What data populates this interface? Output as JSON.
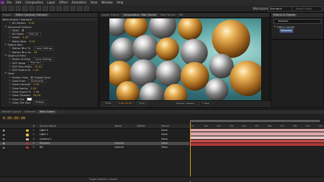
{
  "menu": {
    "items": [
      "File",
      "Edit",
      "Composition",
      "Layer",
      "Effect",
      "Animation",
      "View",
      "Window",
      "Help"
    ]
  },
  "toolbar": {
    "workspace_label": "Workspace:",
    "workspace_value": "Standard",
    "search_placeholder": "Search Help"
  },
  "effect_controls": {
    "tabs": [
      "Project",
      "Effect Controls: Element"
    ],
    "header": "Main Scene • Element",
    "rows": [
      {
        "label": "AO Darken",
        "value": "0.00",
        "fx": true
      },
      {
        "label": "Advanced Options",
        "value": "",
        "twirl": true
      },
      {
        "label": "SSAO",
        "value": "",
        "checkbox": true
      },
      {
        "label": "AO Mode",
        "value": "",
        "dropdown": "FXAA AO"
      },
      {
        "label": "Falloff",
        "value": "0.00"
      },
      {
        "label": "Matte Jitter",
        "value": "0.00"
      },
      {
        "label": "Motion Blur",
        "value": "",
        "twirl": true
      },
      {
        "label": "Motion Blur Ty",
        "value": "",
        "dropdown": "Comp Settings"
      },
      {
        "label": "Motion Blur Sa",
        "value": "16"
      },
      {
        "label": "Depth of Field",
        "value": "",
        "twirl": true
      },
      {
        "label": "Depth of Field",
        "value": "",
        "dropdown": "Comp Settings"
      },
      {
        "label": "DOF Mode",
        "value": "",
        "dropdown": "Pixel Blur"
      },
      {
        "label": "DOF Max Radiu",
        "value": "10.00"
      },
      {
        "label": "DOF Radius M",
        "value": "1.00"
      },
      {
        "label": "Glow",
        "value": "",
        "twirl": true
      },
      {
        "label": "Enable Glow",
        "value": "",
        "checkbox": true,
        "extra": "Enable Glow"
      },
      {
        "label": "Glow From",
        "value": "",
        "dropdown": "Illumination"
      },
      {
        "label": "Glow Intensity",
        "value": "1.00"
      },
      {
        "label": "Glow Radius",
        "value": "0.00"
      },
      {
        "label": "Glow Aspect R",
        "value": "1.00"
      },
      {
        "label": "Glow Threshol",
        "value": "50.00"
      },
      {
        "label": "Glow Tint",
        "value": "",
        "swatch": true
      },
      {
        "label": "Glow Tint Mod",
        "value": "",
        "dropdown": "Multiply"
      }
    ]
  },
  "composition": {
    "tabs": [
      "Layer: (none)",
      "Composition: Main Scene"
    ],
    "sub_tabs": [
      "Main Scene",
      "BG"
    ],
    "footer": [
      "100%",
      "0:00:00:00",
      "(Full)",
      "Active Camera",
      "1 View"
    ]
  },
  "effects_presets": {
    "title": "Effects & Presets",
    "search_value": "element",
    "category": "Video Copilot",
    "item": "Element"
  },
  "timeline": {
    "tabs": [
      "Render Queue",
      "Element",
      "Main Scene"
    ],
    "timecode": "0:00:00:00",
    "headers": {
      "num": "#",
      "name": "Source Name",
      "mode": "Mode",
      "trkmat": "TrkMat",
      "parent": "Parent"
    },
    "layers": [
      {
        "num": "1",
        "name": "Light 2",
        "color": "#e0c040",
        "mode": "",
        "parent": "None"
      },
      {
        "num": "2",
        "name": "Light 1",
        "color": "#e0c040",
        "mode": "",
        "parent": "None"
      },
      {
        "num": "3",
        "name": "Camera 1",
        "color": "#e2b0b0",
        "mode": "",
        "parent": "None"
      },
      {
        "num": "4",
        "name": "Element",
        "color": "#c03030",
        "mode": "Normal",
        "parent": "None",
        "selected": true
      },
      {
        "num": "5",
        "name": "BG",
        "color": "#c03030",
        "mode": "Normal",
        "parent": "None"
      }
    ],
    "bar_colors": [
      "#d9a7a7",
      "#d9a7a7",
      "#e8c4c4",
      "#c34b4b",
      "#b23a3a"
    ],
    "ruler_ticks": [
      "0s",
      "01s",
      "02s",
      "03s",
      "04s",
      "05s",
      "06s",
      "07s",
      "08s",
      "09s",
      "10s"
    ],
    "footer": "Toggle Switches / Modes"
  }
}
